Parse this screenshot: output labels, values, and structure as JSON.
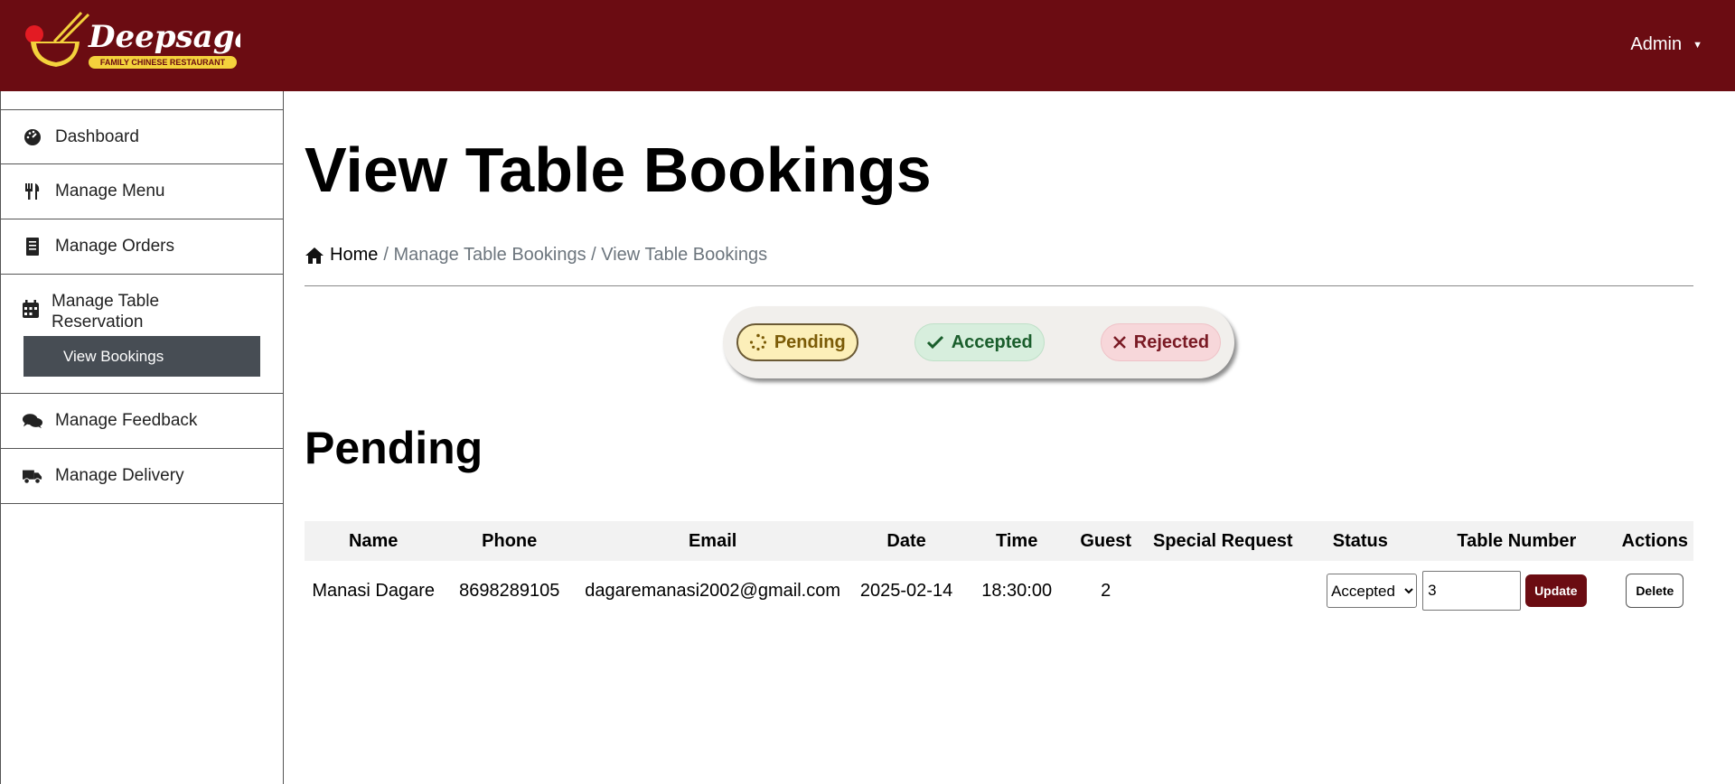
{
  "brand": {
    "name": "Deepsagar",
    "tagline": "FAMILY CHINESE RESTAURANT"
  },
  "header": {
    "user_menu": "Admin"
  },
  "sidebar": {
    "items": [
      {
        "label": "Dashboard",
        "icon": "dashboard-icon"
      },
      {
        "label": "Manage Menu",
        "icon": "utensils-icon"
      },
      {
        "label": "Manage Orders",
        "icon": "receipt-icon"
      },
      {
        "label": "Manage Table Reservation",
        "icon": "calendar-icon",
        "sub_items": [
          {
            "label": "View Bookings",
            "active": true
          }
        ]
      },
      {
        "label": "Manage Feedback",
        "icon": "comments-icon"
      },
      {
        "label": "Manage Delivery",
        "icon": "truck-icon"
      }
    ]
  },
  "page": {
    "title": "View Table Bookings",
    "breadcrumb": {
      "home": "Home",
      "trail": "/ Manage Table Bookings / View Table Bookings"
    }
  },
  "filters": {
    "pending": "Pending",
    "accepted": "Accepted",
    "rejected": "Rejected",
    "active": "pending"
  },
  "section_title": "Pending",
  "table": {
    "columns": [
      "Name",
      "Phone",
      "Email",
      "Date",
      "Time",
      "Guest",
      "Special Request",
      "Status",
      "Table Number",
      "Actions"
    ],
    "rows": [
      {
        "name": "Manasi Dagare",
        "phone": "8698289105",
        "email": "dagaremanasi2002@gmail.com",
        "date": "2025-02-14",
        "time": "18:30:00",
        "guest": "2",
        "special_request": "",
        "status": "Accepted",
        "table_number": "3",
        "update_label": "Update",
        "delete_label": "Delete"
      }
    ]
  },
  "colors": {
    "brand_maroon": "#6b0c12",
    "active_sub": "#474d54"
  }
}
